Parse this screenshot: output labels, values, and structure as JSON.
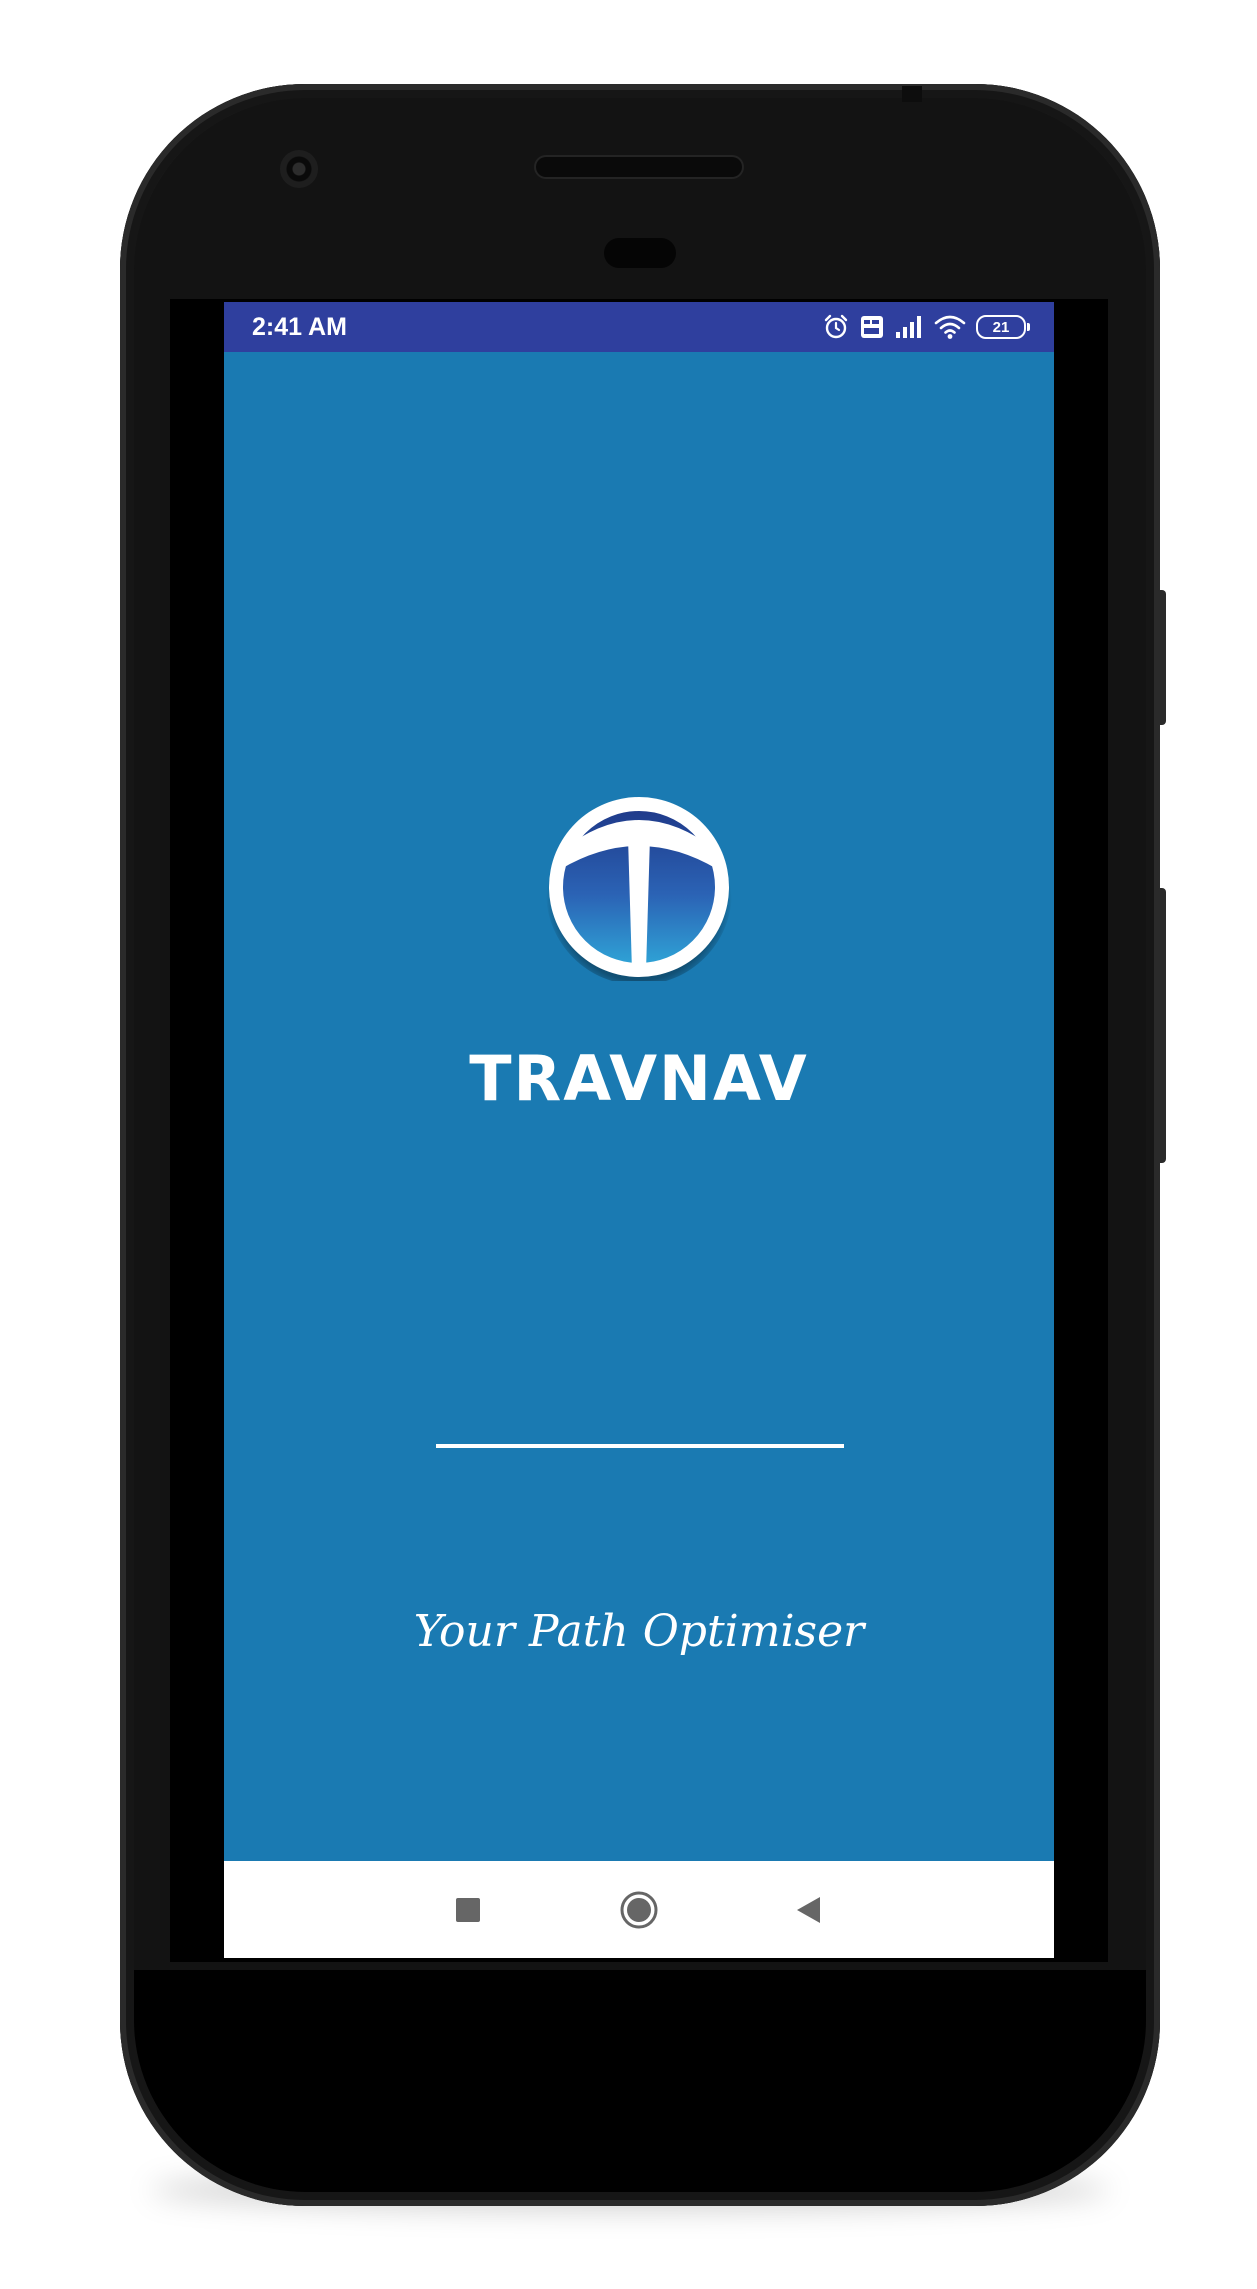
{
  "status_bar": {
    "time": "2:41 AM",
    "battery_level": "21",
    "icons": [
      "alarm-icon",
      "volte-icon",
      "signal-icon",
      "wifi-icon",
      "battery-icon"
    ]
  },
  "splash": {
    "app_name": "TRAVNAV",
    "tagline": "Your Path Optimiser",
    "loading_progress": 1.0
  },
  "nav_bar": {
    "buttons": [
      "recent-apps-button",
      "home-button",
      "back-button"
    ]
  },
  "colors": {
    "status_bar": "#2f3f9e",
    "background": "#1a7ab2",
    "nav_bar": "#ffffff",
    "nav_icon": "#666666",
    "text": "#ffffff"
  }
}
